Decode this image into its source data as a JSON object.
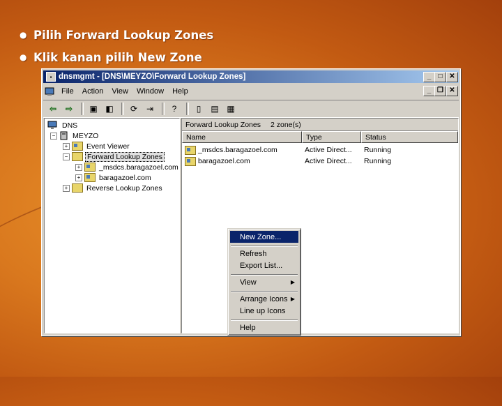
{
  "slide": {
    "bullets": [
      "Pilih Forward Lookup Zones",
      "Klik kanan pilih New Zone"
    ]
  },
  "window": {
    "title": "dnsmgmt - [DNS\\MEYZO\\Forward Lookup Zones]",
    "menu": [
      "File",
      "Action",
      "View",
      "Window",
      "Help"
    ]
  },
  "tree": {
    "root": "DNS",
    "server": "MEYZO",
    "event_viewer": "Event Viewer",
    "forward_zones": "Forward Lookup Zones",
    "zone1": "_msdcs.baragazoel.com",
    "zone2": "baragazoel.com",
    "reverse_zones": "Reverse Lookup Zones"
  },
  "details": {
    "header_title": "Forward Lookup Zones",
    "header_count": "2 zone(s)",
    "columns": [
      "Name",
      "Type",
      "Status"
    ],
    "rows": [
      {
        "name": "_msdcs.baragazoel.com",
        "type": "Active Direct...",
        "status": "Running"
      },
      {
        "name": "baragazoel.com",
        "type": "Active Direct...",
        "status": "Running"
      }
    ]
  },
  "context_menu": {
    "new_zone": "New Zone...",
    "refresh": "Refresh",
    "export_list": "Export List...",
    "view": "View",
    "arrange_icons": "Arrange Icons",
    "line_up_icons": "Line up Icons",
    "help": "Help"
  },
  "colors": {
    "titlebar": "#0a246a",
    "highlight": "#0a246a",
    "background": "#d9781e"
  }
}
